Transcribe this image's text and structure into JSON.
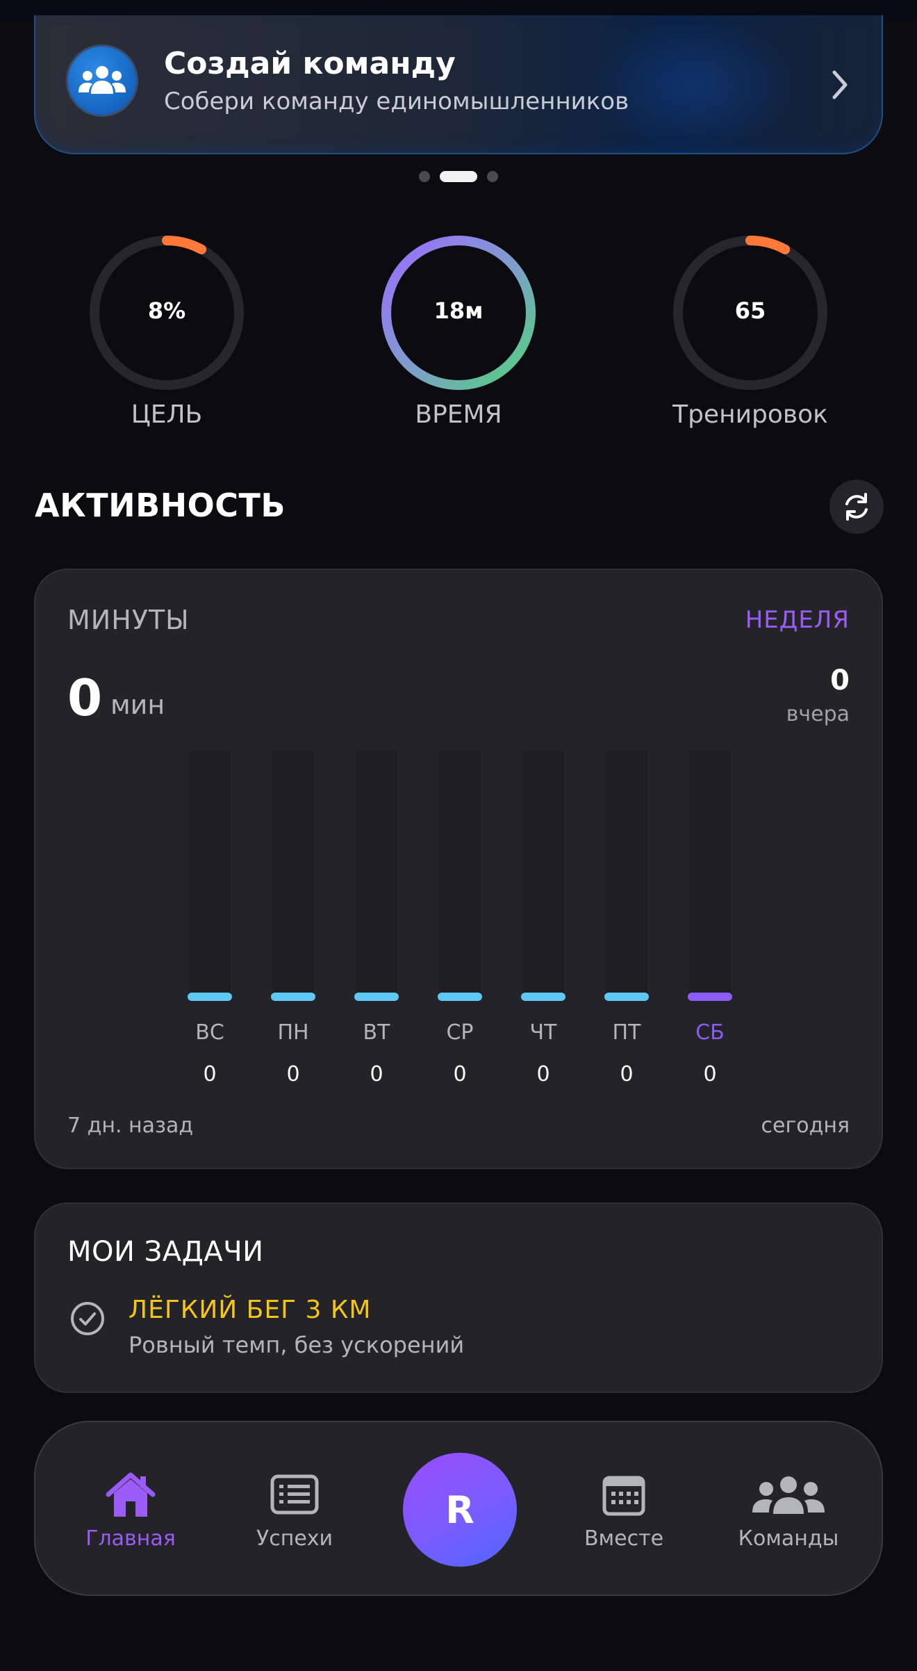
{
  "banner": {
    "title": "Создай команду",
    "subtitle": "Собери команду единомышленников",
    "icon": "users-group-icon",
    "pager": {
      "count": 3,
      "active_index": 1
    }
  },
  "rings": [
    {
      "value_text": "8%",
      "label": "ЦЕЛЬ",
      "progress": 0.08,
      "color": "#ff7a3a"
    },
    {
      "value_text": "18м",
      "label": "ВРЕМЯ",
      "progress": 1.0,
      "color_gradient": [
        "#9b6cff",
        "#4fd37a"
      ]
    },
    {
      "value_text": "65",
      "label": "Тренировок",
      "progress": 0.08,
      "color": "#ff7a3a"
    }
  ],
  "activity": {
    "title": "АКТИВНОСТЬ",
    "refresh_icon": "refresh-icon"
  },
  "chart_card": {
    "label": "МИНУТЫ",
    "period": "НЕДЕЛЯ",
    "total_value": "0",
    "total_unit": "мин",
    "yesterday_value": "0",
    "yesterday_label": "вчера",
    "footer_left": "7 дн. назад",
    "footer_right": "сегодня"
  },
  "chart_data": {
    "type": "bar",
    "categories": [
      "ВС",
      "ПН",
      "ВТ",
      "СР",
      "ЧТ",
      "ПТ",
      "СБ"
    ],
    "values": [
      0,
      0,
      0,
      0,
      0,
      0,
      0
    ],
    "highlight_index": 6,
    "colors": {
      "default": "#5ec8f2",
      "highlight": "#8b5cf6"
    }
  },
  "tasks": {
    "title": "МОИ ЗАДАЧИ",
    "items": [
      {
        "name": "ЛЁГКИЙ БЕГ 3 КМ",
        "description": "Ровный темп, без ускорений",
        "icon": "check-circle-icon"
      }
    ]
  },
  "nav": {
    "items": [
      {
        "label": "Главная",
        "icon": "home-icon",
        "active": true
      },
      {
        "label": "Успехи",
        "icon": "list-icon",
        "active": false
      },
      {
        "label": "Вместе",
        "icon": "calendar-icon",
        "active": false
      },
      {
        "label": "Команды",
        "icon": "users-group-icon",
        "active": false
      }
    ],
    "center_label": "R"
  },
  "colors": {
    "background": "#0b0b10",
    "card": "#232328",
    "accent_purple": "#9b5cf6",
    "accent_orange": "#ff7a3a",
    "task_yellow": "#f5c518"
  }
}
